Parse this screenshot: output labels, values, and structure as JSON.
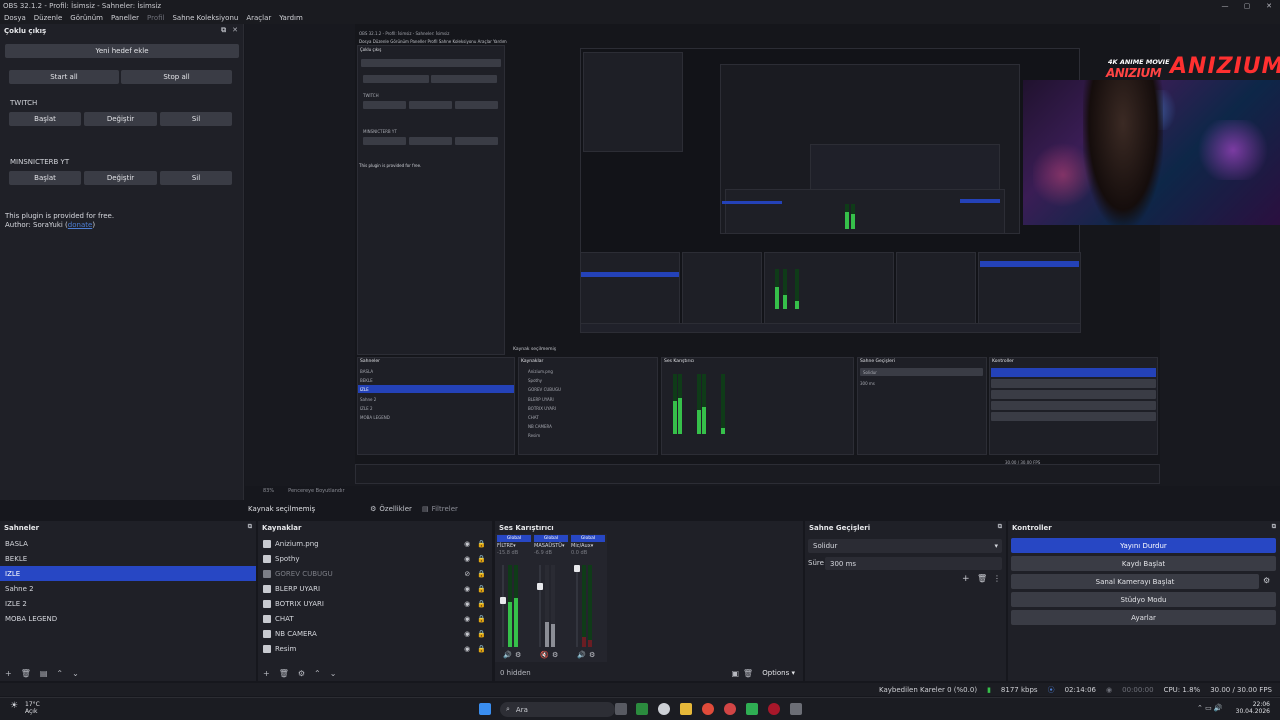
{
  "window": {
    "title": "OBS 32.1.2 - Profil: İsimsiz - Sahneler: İsimsiz",
    "controls": [
      "—",
      "▢",
      "✕"
    ]
  },
  "menu": [
    "Dosya",
    "Düzenle",
    "Görünüm",
    "Paneller",
    "Profil",
    "Sahne Koleksiyonu",
    "Araçlar",
    "Yardım"
  ],
  "multi_output": {
    "title": "Çoklu çıkış",
    "add_target": "Yeni hedef ekle",
    "start_all": "Start all",
    "stop_all": "Stop all",
    "targets": [
      {
        "name": "TWITCH",
        "start": "Başlat",
        "edit": "Değiştir",
        "delete": "Sil"
      },
      {
        "name": "MINSNICTERB YT",
        "start": "Başlat",
        "edit": "Değiştir",
        "delete": "Sil"
      }
    ],
    "plugin_line1": "This plugin is provided for free.",
    "author_prefix": "Author: SoraYuki (",
    "author_link": "donate",
    "author_suffix": ")"
  },
  "branding": {
    "top": "4K ANIME MOVIE",
    "left": "ANIZIUM",
    "right": "ANIZIUM"
  },
  "preview_bar": {
    "zoom": "83%",
    "fit": "Pencereye Boyutlandır"
  },
  "context_bar": {
    "no_source": "Kaynak seçilmemiş",
    "properties": "Özellikler",
    "filters": "Filtreler"
  },
  "scenes": {
    "title": "Sahneler",
    "items": [
      "BASLA",
      "BEKLE",
      "IZLE",
      "Sahne 2",
      "IZLE 2",
      "MOBA LEGEND"
    ],
    "selected_index": 2
  },
  "sources": {
    "title": "Kaynaklar",
    "items": [
      "Anizium.png",
      "Spothy",
      "GOREV CUBUGU",
      "BLERP UYARI",
      "BOTRIX UYARI",
      "CHAT",
      "NB CAMERA",
      "Resim"
    ]
  },
  "mixer": {
    "title": "Ses Karıştırıcı",
    "channels": [
      {
        "group": "Global",
        "name": "FİLTRE",
        "db": "-15.8 dB",
        "level": 0.55
      },
      {
        "group": "Global",
        "name": "MASAÜSTÜ",
        "db": "-6.9 dB",
        "level": 0.3
      },
      {
        "group": "Global",
        "name": "Mic/Aux",
        "db": "0.0 dB",
        "level": 0.0
      }
    ],
    "hidden": "0 hidden",
    "options": "Options"
  },
  "transitions": {
    "title": "Sahne Geçişleri",
    "selected": "Solidur",
    "duration_label": "Süre",
    "duration_value": "300 ms"
  },
  "controls": {
    "title": "Kontroller",
    "buttons": [
      "Yayını Durdur",
      "Kaydı Başlat",
      "Sanal Kamerayı Başlat",
      "Stüdyo Modu",
      "Ayarlar"
    ]
  },
  "status": {
    "dropped": "Kaybedilen Kareler 0 (%0.0)",
    "bitrate": "8177 kbps",
    "stream_time": "02:14:06",
    "rec_time": "00:00:00",
    "cpu": "CPU: 1.8%",
    "fps": "30.00 / 30.00 FPS"
  },
  "taskbar": {
    "weather_temp": "17°C",
    "weather_desc": "Açık",
    "search": "Ara",
    "time": "22:06",
    "date": "30.04.2026"
  },
  "colors": {
    "accent": "#2747c4",
    "panel": "#1f2027",
    "button": "#3a3c45",
    "meter_green": "#36c04a"
  }
}
